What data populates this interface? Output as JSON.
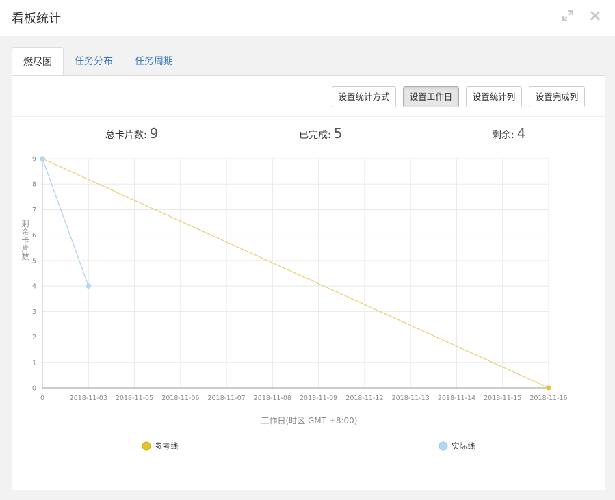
{
  "window": {
    "title": "看板统计",
    "expand_icon": "expand-icon",
    "close_icon": "close-icon"
  },
  "tabs": [
    {
      "label": "燃尽图",
      "active": true
    },
    {
      "label": "任务分布",
      "active": false
    },
    {
      "label": "任务周期",
      "active": false
    }
  ],
  "toolbar": {
    "buttons": [
      {
        "label": "设置统计方式",
        "pressed": false
      },
      {
        "label": "设置工作日",
        "pressed": true
      },
      {
        "label": "设置统计列",
        "pressed": false
      },
      {
        "label": "设置完成列",
        "pressed": false
      }
    ]
  },
  "stats": {
    "total_label": "总卡片数:",
    "total_value": "9",
    "done_label": "已完成:",
    "done_value": "5",
    "remaining_label": "剩余:",
    "remaining_value": "4"
  },
  "chart_data": {
    "type": "line",
    "categories": [
      "0",
      "2018-11-03",
      "2018-11-05",
      "2018-11-06",
      "2018-11-07",
      "2018-11-08",
      "2018-11-09",
      "2018-11-12",
      "2018-11-13",
      "2018-11-14",
      "2018-11-15",
      "2018-11-16"
    ],
    "xlabel": "工作日(时区 GMT +8:00)",
    "ylabel": "剩余卡片数",
    "ylim": [
      0,
      9
    ],
    "yticks": [
      0,
      1,
      2,
      3,
      4,
      5,
      6,
      7,
      8,
      9
    ],
    "grid": true,
    "legend_position": "bottom",
    "series": [
      {
        "name": "参考线",
        "color": "#e6c229",
        "line_color": "#e8cf6e",
        "values": [
          9,
          null,
          null,
          null,
          null,
          null,
          null,
          null,
          null,
          null,
          null,
          0
        ]
      },
      {
        "name": "实际线",
        "color": "#b5d6f5",
        "line_color": "#a9d1ee",
        "values": [
          9,
          4,
          null,
          null,
          null,
          null,
          null,
          null,
          null,
          null,
          null,
          null
        ]
      }
    ]
  }
}
